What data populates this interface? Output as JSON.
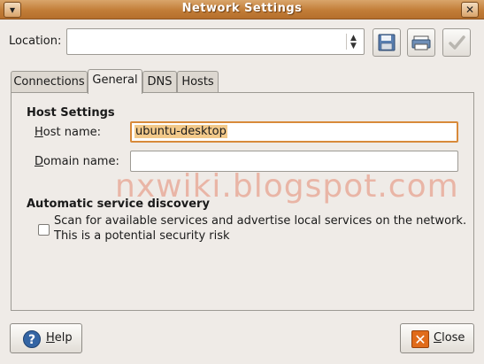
{
  "window": {
    "title": "Network Settings",
    "menu_glyph": "▾",
    "close_glyph": "✕"
  },
  "location": {
    "label": "Location:",
    "value": ""
  },
  "toolbar_icons": [
    "save-floppy-icon",
    "delete-printer-icon",
    "apply-check-icon"
  ],
  "tabs": [
    {
      "label": "Connections"
    },
    {
      "label": "General"
    },
    {
      "label": "DNS"
    },
    {
      "label": "Hosts"
    }
  ],
  "host_settings": {
    "title": "Host Settings",
    "host_name_label_first": "H",
    "host_name_label_rest": "ost name:",
    "host_name_value": "ubuntu-desktop",
    "domain_name_label_first": "D",
    "domain_name_label_rest": "omain name:",
    "domain_name_value": ""
  },
  "discovery": {
    "title": "Automatic service discovery",
    "checkbox_line1": "Scan for available services and advertise local services on the network.",
    "checkbox_line2": "This is a potential security risk",
    "checked": false
  },
  "watermark": "nxwiki.blogspot.com",
  "buttons": {
    "help_first": "H",
    "help_rest": "elp",
    "close_first": "C",
    "close_rest": "lose"
  },
  "colors": {
    "titlebar": "#c27d38",
    "focus": "#d88a3a",
    "selection": "#f2c98a"
  }
}
